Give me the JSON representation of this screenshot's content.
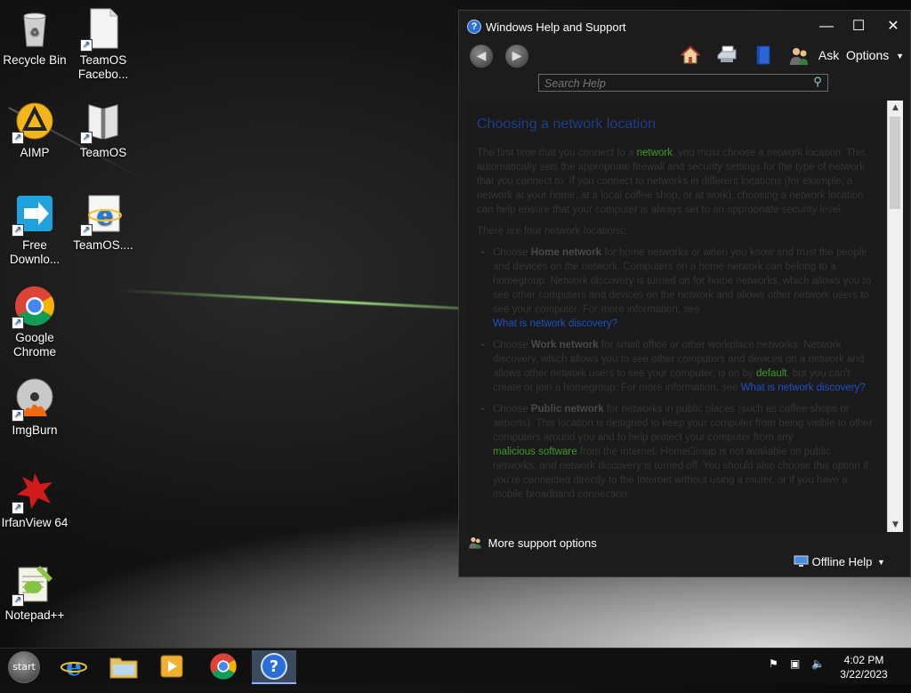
{
  "desktop": {
    "icons": [
      {
        "label": "Recycle Bin"
      },
      {
        "label": "TeamOS Facebo..."
      },
      {
        "label": "AIMP"
      },
      {
        "label": "TeamOS"
      },
      {
        "label": "Free Downlo..."
      },
      {
        "label": "TeamOS...."
      },
      {
        "label": "Google Chrome"
      },
      {
        "label": "ImgBurn"
      },
      {
        "label": "IrfanView 64"
      },
      {
        "label": "Notepad++"
      }
    ]
  },
  "window": {
    "title": "Windows Help and Support",
    "toolbar": {
      "ask_label": "Ask",
      "options_label": "Options"
    },
    "search": {
      "placeholder": "Search Help"
    },
    "article": {
      "heading": "Choosing a network location",
      "intro_pre": "The first time that you connect to a ",
      "intro_link": "network",
      "intro_post": ", you must choose a network location. This automatically sets the appropriate firewall and security settings for the type of network that you connect to. If you connect to networks in different locations (for example, a network at your home, at a local coffee shop, or at work), choosing a network location can help ensure that your computer is always set to an appropriate security level.",
      "four_locations": "There are four network locations:",
      "home": {
        "pre": "Choose ",
        "bold": "Home network",
        "text": " for home networks or when you know and trust the people and devices on the network. Computers on a home network can belong to a homegroup. Network discovery is turned on for home networks, which allows you to see other computers and devices on the network and allows other network users to see your computer. For more information, see",
        "link": "What is network discovery?"
      },
      "work": {
        "pre": "Choose ",
        "bold": "Work network",
        "text1": " for small office or other workplace networks. Network discovery, which allows you to see other computers and devices on a network and allows other network users to see your computer, is on by ",
        "green": "default",
        "text2": ", but you can't create or join a homegroup. For more information, see ",
        "link": "What is network discovery?"
      },
      "public": {
        "pre": "Choose ",
        "bold": "Public network",
        "text1": " for networks in public places (such as coffee shops or airports). This location is designed to keep your computer from being visible to other computers around you and to help protect your computer from any",
        "green": "malicious software",
        "text2": " from the Internet. HomeGroup is not available on public networks, and network discovery is turned off. You should also choose this option if you're connected directly to the Internet without using a router, or if you have a mobile broadband connection."
      }
    },
    "more_support": "More support options",
    "offline_help": "Offline Help"
  },
  "taskbar": {
    "start_label": "start",
    "clock_time": "4:02 PM",
    "clock_date": "3/22/2023"
  },
  "colors": {
    "link": "#1f4fc7",
    "green_link": "#3f9b2b",
    "heading": "#1e3d8c"
  }
}
